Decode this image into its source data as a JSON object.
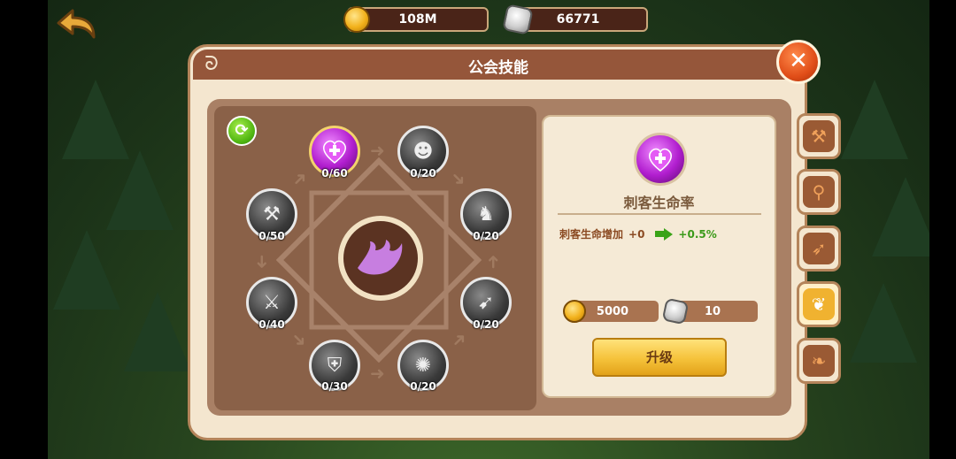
{
  "top": {
    "gold": "108M",
    "stones": "66771"
  },
  "panel": {
    "title": "公会技能",
    "close_icon": "close-icon"
  },
  "skills": [
    {
      "name": "purple-heart",
      "level": "0/60",
      "active": true
    },
    {
      "name": "shadow-figure",
      "level": "0/20"
    },
    {
      "name": "shadow-wolf",
      "level": "0/20"
    },
    {
      "name": "shadow-dash",
      "level": "0/20"
    },
    {
      "name": "ground-impact",
      "level": "0/20"
    },
    {
      "name": "shield-breaker",
      "level": "0/30"
    },
    {
      "name": "sword-slash",
      "level": "0/40"
    },
    {
      "name": "blade-strike",
      "level": "0/50"
    }
  ],
  "info": {
    "skill_name": "刺客生命率",
    "effect_label": "刺客生命增加",
    "current": "+0",
    "next": "+0.5%",
    "cost_gold": "5000",
    "cost_stone": "10",
    "upgrade_label": "升级"
  },
  "tabs": [
    {
      "name": "warrior-tab",
      "active": false
    },
    {
      "name": "mage-tab",
      "active": false
    },
    {
      "name": "archer-tab",
      "active": false
    },
    {
      "name": "assassin-tab",
      "active": true
    },
    {
      "name": "support-tab",
      "active": false
    }
  ],
  "colors": {
    "panel_bg": "#f4e6cf",
    "title_bar": "#95563a",
    "upgrade_button": "#f5c23a",
    "active_skill": "#b11ecf"
  }
}
